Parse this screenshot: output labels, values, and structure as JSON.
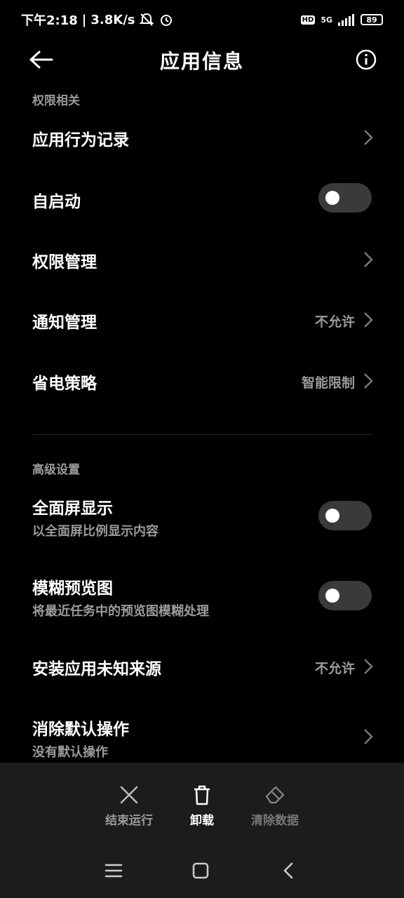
{
  "status_bar": {
    "time": "下午2:18",
    "speed": "3.8K/s",
    "hd": "HD",
    "network": "5G",
    "battery": "89"
  },
  "header": {
    "title": "应用信息"
  },
  "sections": {
    "permissions": {
      "label": "权限相关",
      "items": [
        {
          "title": "应用行为记录"
        },
        {
          "title": "自启动",
          "toggle": false
        },
        {
          "title": "权限管理"
        },
        {
          "title": "通知管理",
          "value": "不允许"
        },
        {
          "title": "省电策略",
          "value": "智能限制"
        }
      ]
    },
    "advanced": {
      "label": "高级设置",
      "items": [
        {
          "title": "全面屏显示",
          "subtitle": "以全面屏比例显示内容",
          "toggle": false
        },
        {
          "title": "模糊预览图",
          "subtitle": "将最近任务中的预览图模糊处理",
          "toggle": false
        },
        {
          "title": "安装应用未知来源",
          "value": "不允许"
        },
        {
          "title": "消除默认操作",
          "subtitle": "没有默认操作"
        }
      ]
    }
  },
  "bottom_actions": {
    "force_stop": "结束运行",
    "uninstall": "卸载",
    "clear_data": "清除数据"
  },
  "colors": {
    "background": "#000000",
    "secondary_text": "#9a9a9a",
    "toggle_off": "#3a3a3a",
    "bottom_bar": "#1c1c1c"
  }
}
